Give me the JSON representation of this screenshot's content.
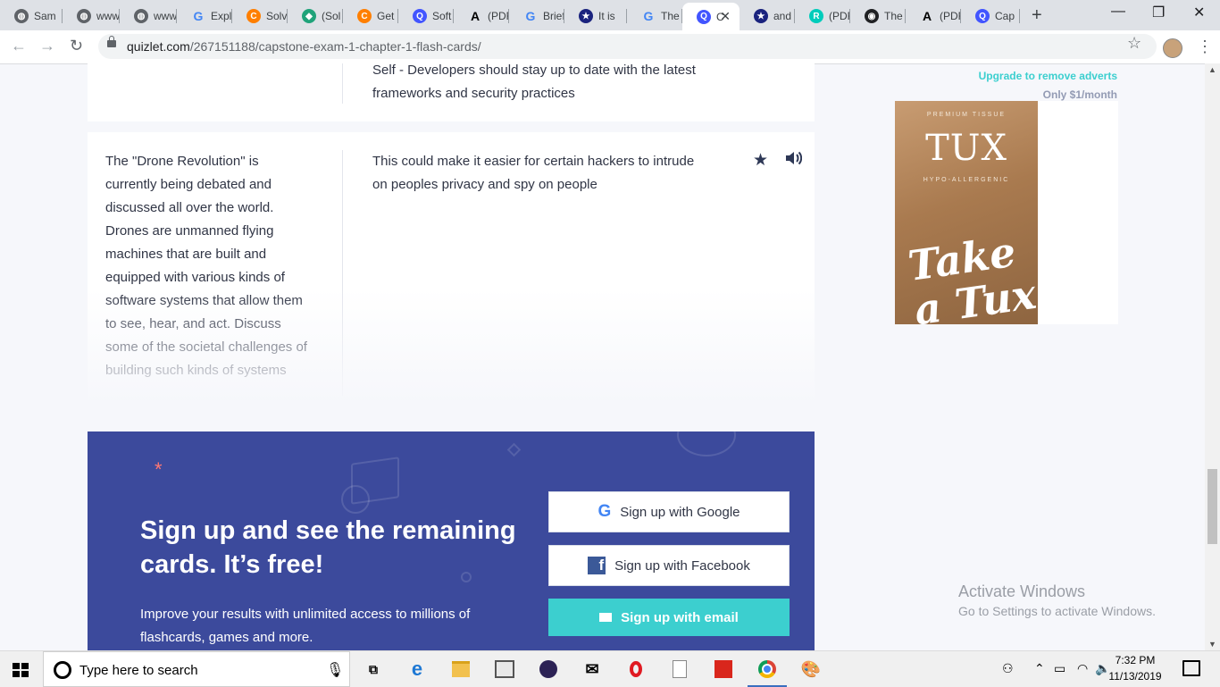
{
  "browser": {
    "tabs": [
      {
        "label": "Sam",
        "icon": "globe-icon",
        "color": "#5f6368"
      },
      {
        "label": "www",
        "icon": "globe-icon",
        "color": "#5f6368"
      },
      {
        "label": "www",
        "icon": "globe-icon",
        "color": "#5f6368"
      },
      {
        "label": "Expl",
        "icon": "google-icon",
        "color": "#4285f4"
      },
      {
        "label": "Solv",
        "icon": "chegg-icon",
        "color": "#ff7f00"
      },
      {
        "label": "(Sol",
        "icon": "coursehero-icon",
        "color": "#20a37a"
      },
      {
        "label": "Get",
        "icon": "chegg-icon",
        "color": "#ff7f00"
      },
      {
        "label": "Soft",
        "icon": "quizlet-icon",
        "color": "#4255ff"
      },
      {
        "label": "(PDF",
        "icon": "academia-icon",
        "color": "#000000"
      },
      {
        "label": "Brief",
        "icon": "google-icon",
        "color": "#4285f4"
      },
      {
        "label": "It is",
        "icon": "star-badge-icon",
        "color": "#1a237e"
      },
      {
        "label": "The",
        "icon": "google-icon",
        "color": "#4285f4"
      },
      {
        "label": "C",
        "icon": "quizlet-icon",
        "color": "#4255ff",
        "active": true
      },
      {
        "label": "and",
        "icon": "star-badge-icon",
        "color": "#1a237e"
      },
      {
        "label": "(PDF",
        "icon": "researchgate-icon",
        "color": "#00ccbb"
      },
      {
        "label": "The",
        "icon": "site-icon",
        "color": "#202124"
      },
      {
        "label": "(PDF",
        "icon": "academia-icon",
        "color": "#000000"
      },
      {
        "label": "Cap",
        "icon": "quizlet-icon",
        "color": "#4255ff"
      }
    ],
    "new_tab": "+",
    "url_host": "quizlet.com",
    "url_path": "/267151188/capstone-exam-1-chapter-1-flash-cards/"
  },
  "cards": {
    "prev_definition": "Self - Developers should stay up to date with the latest frameworks and security practices",
    "term": "The \"Drone Revolution\" is currently being debated and discussed all over the world. Drones are unmanned flying machines that are built and equipped with various kinds of software systems that allow them to see, hear, and act. Discuss some of the societal challenges of building such kinds of systems",
    "definition": "This could make it easier for certain hackers to intrude on peoples privacy and spy on people"
  },
  "promo": {
    "title": "Sign up and see the remaining cards. It’s free!",
    "subtitle": "Improve your results with unlimited access to millions of flashcards, games and more.",
    "google_label": "Sign up with Google",
    "facebook_label": "Sign up with Facebook",
    "email_label": "Sign up with email",
    "accent": "#3ccfcf",
    "background": "#3c4a9c"
  },
  "ad": {
    "upgrade_link": "Upgrade to remove adverts",
    "price": "Only $1/month",
    "premium_text": "PREMIUM TISSUE",
    "brand": "TUX",
    "hypo_text": "HYPO-ALLERGENIC",
    "tagline": "Take a Tux"
  },
  "watermark": {
    "title": "Activate Windows",
    "subtitle": "Go to Settings to activate Windows."
  },
  "taskbar": {
    "search_placeholder": "Type here to search",
    "time": "7:32 PM",
    "date": "11/13/2019"
  }
}
